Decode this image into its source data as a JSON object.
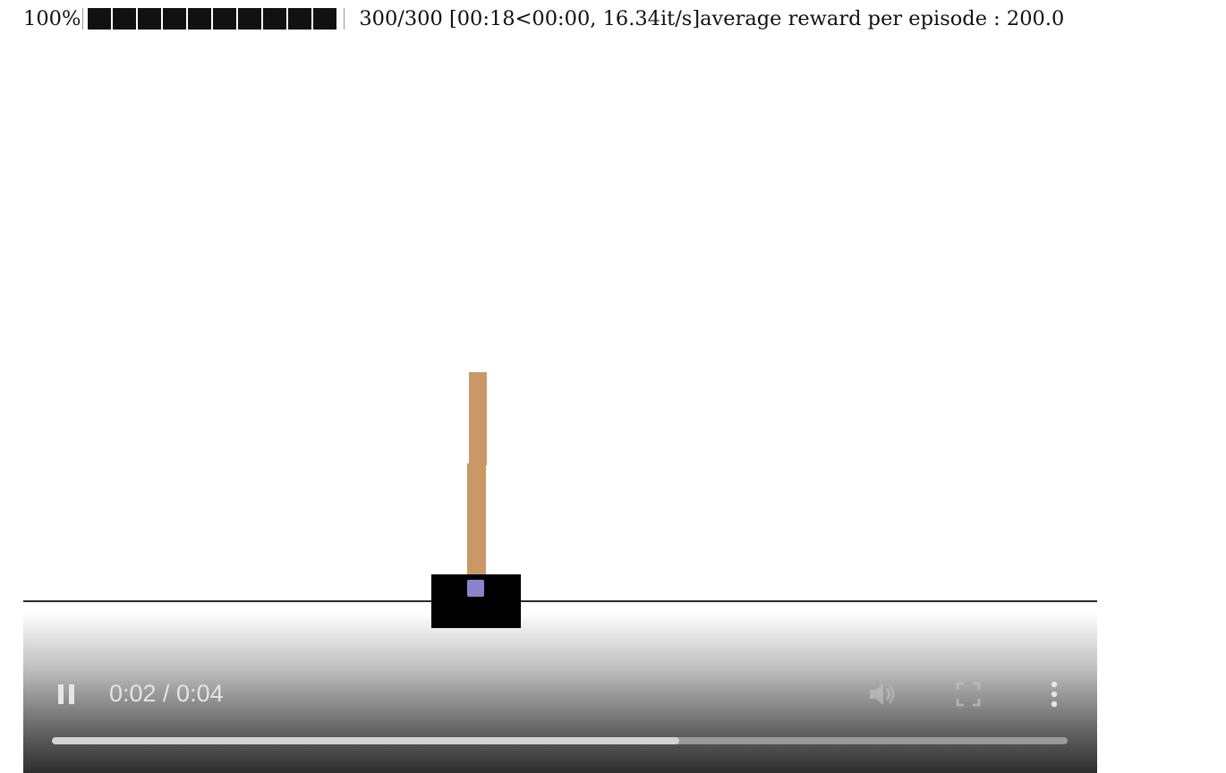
{
  "cell_output": {
    "percent": "100%",
    "progress_fraction": 1.0,
    "stats": "300/300 [00:18<00:00, 16.34it/s]average reward per episode : 200.0"
  },
  "video_player": {
    "time": "0:02 / 0:04",
    "played_fraction": 0.618,
    "icons": [
      "pause-icon",
      "volume-icon",
      "fullscreen-icon",
      "more-options-icon"
    ],
    "colors": {
      "cart": "#000000",
      "pole": "#ca9866",
      "axle": "#8a84cc",
      "track": "#2a2a2a",
      "controls": "#e6e6e6"
    }
  }
}
